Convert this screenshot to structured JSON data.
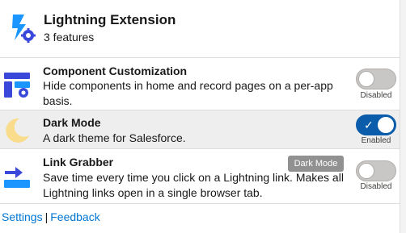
{
  "header": {
    "title": "Lightning Extension",
    "subtitle": "3 features",
    "icon": "lightning-gear-icon"
  },
  "features": [
    {
      "title": "Component Customization",
      "description": "Hide components in home and record pages on a per-app basis.",
      "icon": "layout-gear-icon",
      "enabled": false,
      "status": "Disabled"
    },
    {
      "title": "Dark Mode",
      "description": "A dark theme for Salesforce.",
      "icon": "moon-icon",
      "enabled": true,
      "status": "Enabled"
    },
    {
      "title": "Link Grabber",
      "description": "Save time every time you click on a Lightning link. Makes all Lightning links open in a single browser tab.",
      "icon": "link-arrow-icon",
      "enabled": false,
      "status": "Disabled"
    }
  ],
  "tooltip": "Dark Mode",
  "footer": {
    "settings": "Settings",
    "separator": "|",
    "feedback": "Feedback"
  },
  "colors": {
    "accent": "#0b5cab",
    "link": "#0176d3",
    "icon_blue": "#1b96ff",
    "icon_navy": "#3a49da",
    "moon": "#f9dd8c"
  }
}
